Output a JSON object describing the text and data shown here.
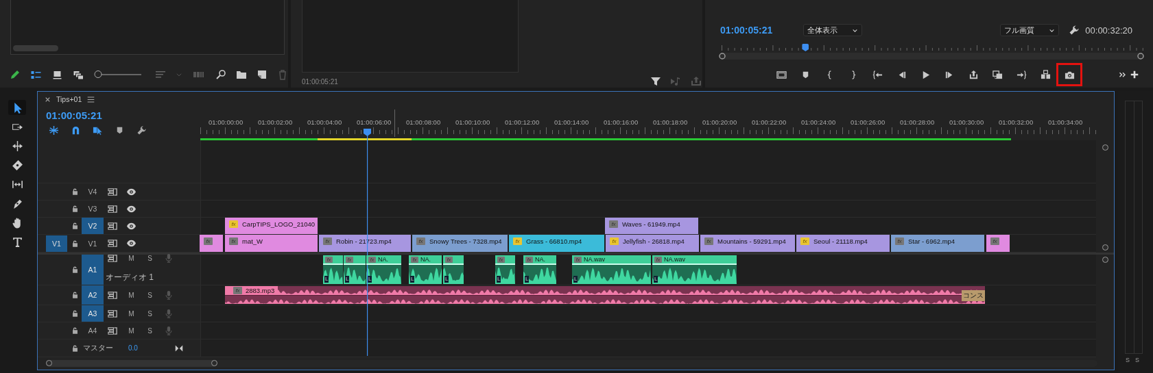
{
  "project_panel": {
    "view_buttons": [
      {
        "kind": "list",
        "selected": true
      },
      {
        "kind": "icon",
        "selected": false
      },
      {
        "kind": "freeform",
        "selected": false
      }
    ],
    "zoom_slider": {
      "level": 0
    }
  },
  "source_monitor": {
    "timecode": "01:00:05:21"
  },
  "program_monitor": {
    "timecode": "01:00:05:21",
    "zoom": "全体表示",
    "quality": "フル画質",
    "duration": "00:00:32:20",
    "scrubber": {
      "level": 0.2
    },
    "buttons": [
      {
        "kind": "safe-margins",
        "highlighted": false
      },
      {
        "kind": "marker",
        "highlighted": false
      },
      {
        "kind": "mark-in",
        "highlighted": false
      },
      {
        "kind": "mark-out",
        "highlighted": false
      },
      {
        "kind": "go-to-in",
        "highlighted": false
      },
      {
        "kind": "step-back",
        "highlighted": false
      },
      {
        "kind": "play",
        "highlighted": false
      },
      {
        "kind": "step-forward",
        "highlighted": false
      },
      {
        "kind": "lift",
        "highlighted": false
      },
      {
        "kind": "extract",
        "highlighted": false
      },
      {
        "kind": "go-to-out",
        "highlighted": false
      },
      {
        "kind": "compare",
        "highlighted": false
      },
      {
        "kind": "export-frame",
        "highlighted": true
      }
    ]
  },
  "tools": [
    {
      "kind": "selection",
      "selected": true
    },
    {
      "kind": "track-select",
      "selected": false
    },
    {
      "kind": "ripple",
      "selected": false
    },
    {
      "kind": "razor",
      "selected": false
    },
    {
      "kind": "slip",
      "selected": false
    },
    {
      "kind": "pen",
      "selected": false
    },
    {
      "kind": "hand",
      "selected": false
    },
    {
      "kind": "type",
      "selected": false
    }
  ],
  "timeline": {
    "tab": "Tips+01",
    "timecode": "01:00:05:21",
    "controls": [
      {
        "kind": "nest",
        "on": true
      },
      {
        "kind": "snap",
        "on": true
      },
      {
        "kind": "linked",
        "on": true
      },
      {
        "kind": "marker",
        "on": false
      },
      {
        "kind": "settings",
        "on": false
      }
    ],
    "ruler_labels": [
      "01:00:00:00",
      "01:00:02:00",
      "01:00:04:00",
      "01:00:06:00",
      "01:00:08:00",
      "01:00:10:00",
      "01:00:12:00",
      "01:00:14:00",
      "01:00:16:00",
      "01:00:18:00",
      "01:00:20:00",
      "01:00:22:00",
      "01:00:24:00",
      "01:00:26:00",
      "01:00:28:00",
      "01:00:30:00",
      "01:00:32:00",
      "01:00:34:00"
    ],
    "video_tracks": [
      {
        "name": "V4",
        "targeted": false
      },
      {
        "name": "V3",
        "targeted": false
      },
      {
        "name": "V2",
        "targeted": true,
        "clips": [
          {
            "name": "CarpTIPS_LOGO_21040",
            "badge": "fx",
            "fx_applied": true,
            "color": "#e08ae0"
          },
          {
            "name": "Waves - 61949.mp4",
            "badge": "fx",
            "fx_applied": false,
            "color": "#a796e0"
          }
        ]
      },
      {
        "name": "V1",
        "targeted": false,
        "source_patch": "V1",
        "clips": [
          {
            "badge": "fx",
            "fx_applied": false,
            "color": "#e08ae0"
          },
          {
            "name": "mat_W",
            "badge": "fx",
            "fx_applied": false,
            "color": "#e08ae0"
          },
          {
            "name": "Robin - 21723.mp4",
            "badge": "fx",
            "fx_applied": false,
            "color": "#a796e0"
          },
          {
            "name": "Snowy Trees - 7328.mp4",
            "badge": "fx",
            "fx_applied": false,
            "color": "#7c9ecf"
          },
          {
            "name": "Grass - 66810.mp4",
            "badge": "fx",
            "fx_applied": true,
            "color": "#3bbbd9"
          },
          {
            "name": "Jellyfish - 26818.mp4",
            "badge": "fx",
            "fx_applied": true,
            "color": "#a796e0"
          },
          {
            "name": "Mountains - 59291.mp4",
            "badge": "fx",
            "fx_applied": false,
            "color": "#a796e0"
          },
          {
            "name": "Seoul - 21118.mp4",
            "badge": "fx",
            "fx_applied": true,
            "color": "#a796e0"
          },
          {
            "name": "Star - 6962.mp4",
            "badge": "fx",
            "fx_applied": false,
            "color": "#7c9ecf"
          },
          {
            "badge": "fx",
            "fx_applied": false,
            "color": "#e08ae0"
          }
        ]
      }
    ],
    "audio_tracks": [
      {
        "name": "A1",
        "targeted": true,
        "label": "オーディオ 1",
        "mute": "M",
        "solo": "S",
        "clips": [
          {
            "badge": "fx",
            "channel": "L"
          },
          {
            "badge": "fx",
            "channel": "L"
          },
          {
            "name": "NA.",
            "badge": "fx",
            "channel": "L"
          },
          {
            "name": "NA.",
            "badge": "fx",
            "channel": "L"
          },
          {
            "badge": "fx",
            "channel": "L"
          },
          {
            "badge": "fx",
            "channel": "L"
          },
          {
            "name": "NA.",
            "badge": "fx",
            "channel": "L"
          },
          {
            "name": "NA.wav",
            "badge": "fx",
            "channel": "L"
          },
          {
            "name": "NA.wav",
            "badge": "fx",
            "channel": "L"
          }
        ]
      },
      {
        "name": "A2",
        "targeted": true,
        "mute": "M",
        "solo": "S",
        "clips": [
          {
            "name": "2883.mp3",
            "badge": "fx",
            "color": "#f07aa8",
            "end_label": "コンス"
          }
        ]
      },
      {
        "name": "A3",
        "targeted": true,
        "mute": "M",
        "solo": "S"
      },
      {
        "name": "A4",
        "targeted": false,
        "mute": "M",
        "solo": "S"
      }
    ],
    "master": {
      "name": "マスター",
      "value": "0.0"
    }
  },
  "meter": {
    "solo_labels": [
      "S",
      "S"
    ]
  }
}
